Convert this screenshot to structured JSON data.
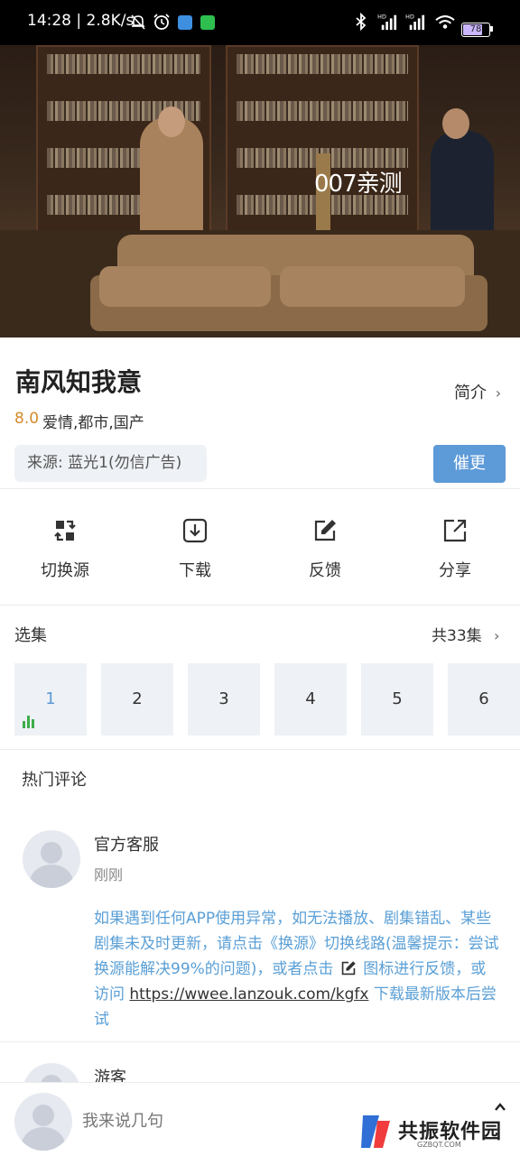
{
  "status_bar": {
    "time": "14:28",
    "speed": "2.8K/s",
    "battery": "78"
  },
  "video": {
    "watermark": "007亲测"
  },
  "show": {
    "title": "南风知我意",
    "intro_label": "简介",
    "rating": "8.0",
    "genres": "爱情,都市,国产",
    "source": "来源: 蓝光1(勿信广告)",
    "urge_button": "催更"
  },
  "actions": [
    {
      "label": "切换源",
      "icon": "switch-source-icon"
    },
    {
      "label": "下载",
      "icon": "download-icon"
    },
    {
      "label": "反馈",
      "icon": "edit-icon"
    },
    {
      "label": "分享",
      "icon": "share-icon"
    }
  ],
  "episodes": {
    "title": "选集",
    "total": "共33集",
    "items": [
      "1",
      "2",
      "3",
      "4",
      "5",
      "6"
    ],
    "selected": "1",
    "active_color": "#5d9ad8"
  },
  "comments": {
    "section_title": "热门评论",
    "items": [
      {
        "name": "官方客服",
        "time": "刚刚",
        "text_part1": "如果遇到任何APP使用异常，如无法播放、剧集错乱、某些剧集未及时更新，请点击《换源》切换线路(温馨提示：尝试换源能解决99%的问题)，或者点击",
        "text_part2": "图标进行反馈，或访问",
        "link": "https://wwee.lanzouk.com/kgfx",
        "text_part3": "下载最新版本后尝试"
      },
      {
        "name": "游客"
      }
    ]
  },
  "bottom": {
    "input_placeholder": "我来说几句",
    "logo_text": "共振软件园",
    "logo_sub": "GZBQT.COM"
  }
}
